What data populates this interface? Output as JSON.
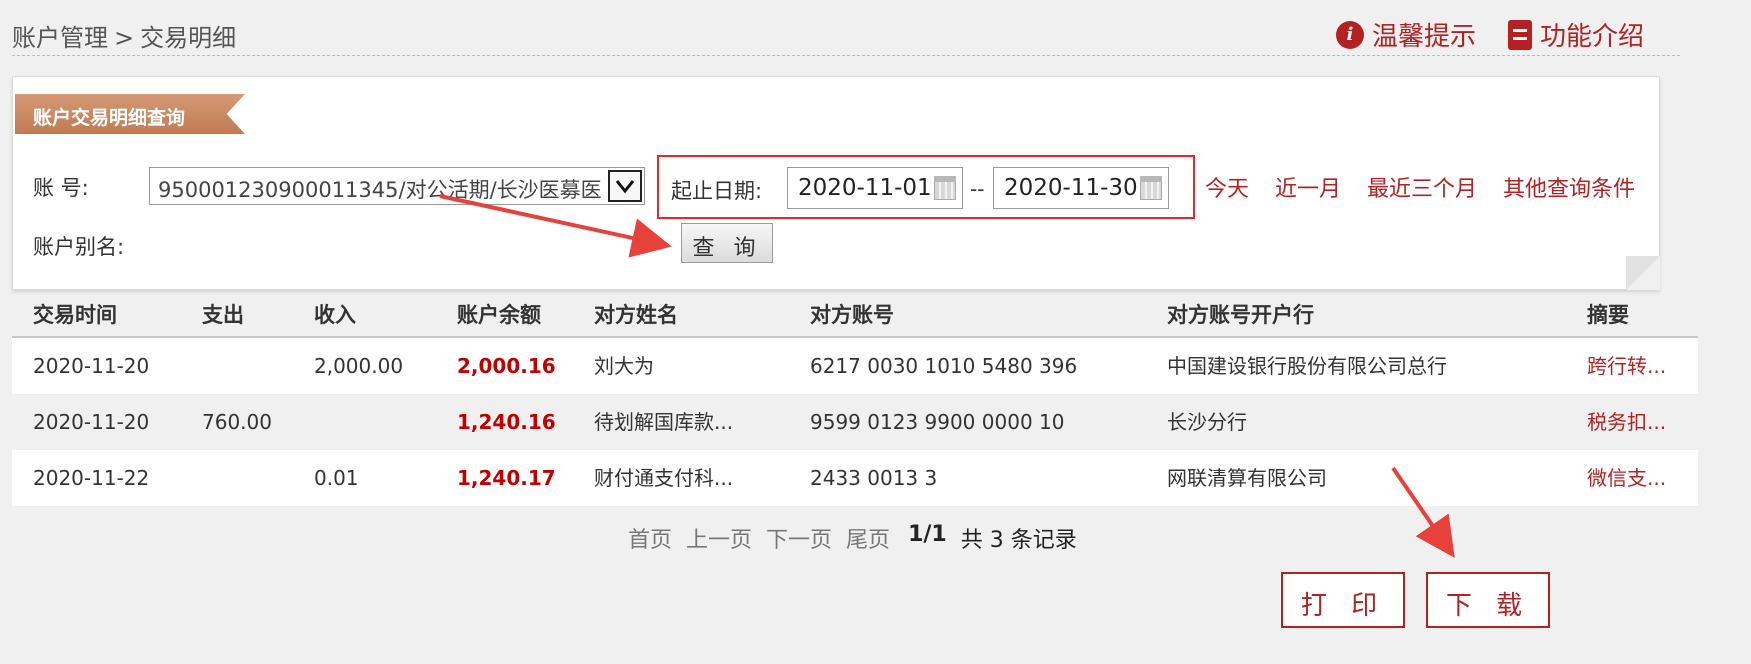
{
  "breadcrumb": {
    "section": "账户管理",
    "separator": ">",
    "page": "交易明细"
  },
  "top_links": {
    "tips": "温馨提示",
    "intro": "功能介绍"
  },
  "panel": {
    "title": "账户交易明细查询",
    "account_label": "账 号:",
    "account_value": "950001230900011345/对公活期/长沙医募医",
    "alias_label": "账户别名:",
    "date_label": "起止日期:",
    "start_date": "2020-11-01",
    "date_sep": "--",
    "end_date": "2020-11-30",
    "quick": [
      "今天",
      "近一月",
      "最近三个月",
      "其他查询条件"
    ],
    "query_button": "查 询"
  },
  "table": {
    "headers": [
      "交易时间",
      "支出",
      "收入",
      "账户余额",
      "对方姓名",
      "对方账号",
      "对方账号开户行",
      "摘要"
    ],
    "rows": [
      [
        "2020-11-20",
        "",
        "2,000.00",
        "2,000.16",
        "刘大为",
        "6217 0030 1010 5480 396",
        "中国建设银行股份有限公司总行",
        "跨行转..."
      ],
      [
        "2020-11-20",
        "760.00",
        "",
        "1,240.16",
        "待划解国库款...",
        "9599 0123 9900 0000 10",
        "长沙分行",
        "税务扣..."
      ],
      [
        "2020-11-22",
        "",
        "0.01",
        "1,240.17",
        "财付通支付科...",
        "2433 0013 3",
        "网联清算有限公司",
        "微信支..."
      ]
    ]
  },
  "pager": {
    "first": "首页",
    "prev": "上一页",
    "next": "下一页",
    "last": "尾页",
    "current": "1/1",
    "total": "共 3 条记录"
  },
  "actions": {
    "print": "打 印",
    "download": "下 载"
  },
  "colors": {
    "accent": "#b22222",
    "highlight_box": "#e02b2b",
    "balance": "#c00000",
    "tab": "#c8885f"
  }
}
